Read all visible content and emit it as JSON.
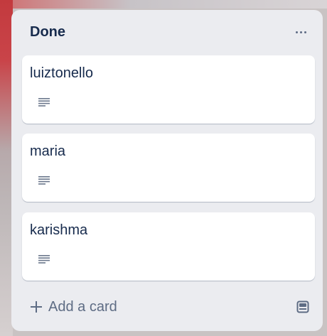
{
  "list": {
    "title": "Done",
    "more_icon": "more-horizontal-icon",
    "cards": [
      {
        "title": "luiztonello",
        "icon": "description-icon"
      },
      {
        "title": "maria",
        "icon": "description-icon"
      },
      {
        "title": "karishma",
        "icon": "description-icon"
      }
    ],
    "footer": {
      "add_card_label": "Add a card",
      "add_icon": "plus-icon",
      "template_icon": "card-template-icon"
    }
  },
  "colors": {
    "list_bg": "#ebecf0",
    "card_bg": "#ffffff",
    "text": "#172b4d",
    "muted": "#5e6c84",
    "board_accent": "#c33a3e"
  }
}
